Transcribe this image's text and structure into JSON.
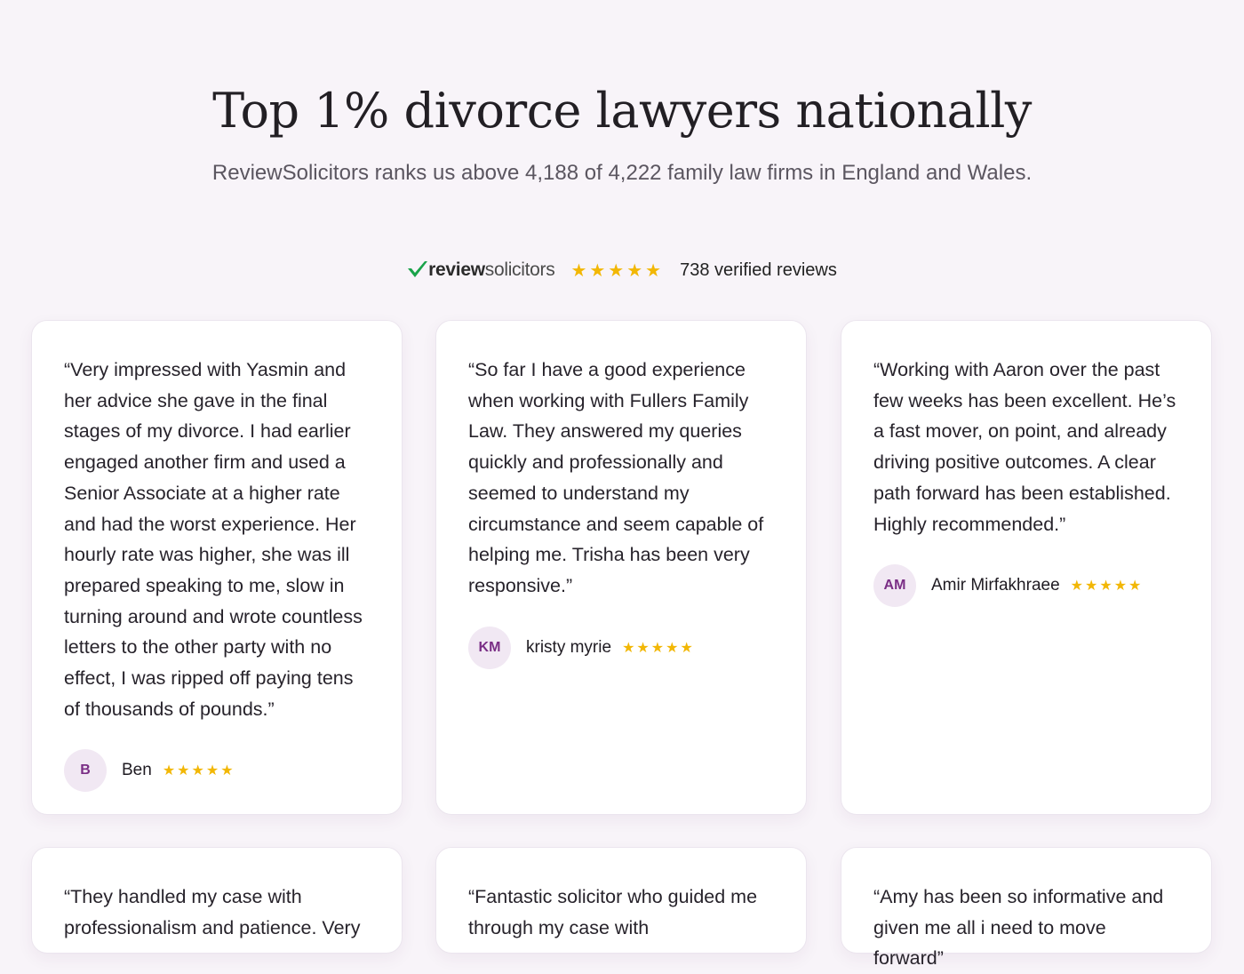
{
  "hero": {
    "title": "Top 1% divorce lawyers nationally",
    "subtitle": "ReviewSolicitors ranks us above 4,188 of 4,222 family law firms in England and Wales."
  },
  "rating_bar": {
    "brand_icon": "check-mark-icon",
    "brand_part1": "review",
    "brand_part2": "solicitors",
    "stars": "★★★★★",
    "rating": 5,
    "reviews_text": "738 verified reviews"
  },
  "colors": {
    "background": "#f8f4f9",
    "star": "#f2b705",
    "avatar_bg": "#f1e8f3",
    "avatar_text": "#7a2e85",
    "brand_check": "#1aa34a"
  },
  "reviews": [
    {
      "quote": "“Very impressed with Yasmin and her advice she gave in the final stages of my divorce. I had earlier engaged another firm and used a Senior Associate at a higher rate and had the worst experience. Her hourly rate was higher, she was ill prepared speaking to me, slow in turning around and wrote countless letters to the other party with no effect, I was ripped off paying tens of thousands of pounds.”",
      "initials": "B",
      "name": "Ben",
      "stars": "★★★★★",
      "rating": 5
    },
    {
      "quote": "“So far I have a good experience when working with Fullers Family Law. They answered my queries quickly and professionally and seemed to understand my circumstance and seem capable of helping me. Trisha has been very responsive.”",
      "initials": "KM",
      "name": "kristy myrie",
      "stars": "★★★★★",
      "rating": 5
    },
    {
      "quote": "“Working with Aaron over the past few weeks has been excellent. He’s a fast mover, on point, and already driving positive outcomes. A clear path forward has been established. Highly recommended.”",
      "initials": "AM",
      "name": "Amir Mirfakhraee",
      "stars": "★★★★★",
      "rating": 5
    },
    {
      "quote": "“They handled my case with professionalism and patience. Very"
    },
    {
      "quote": "“Fantastic solicitor who guided me through my case with"
    },
    {
      "quote": "“Amy has been so informative and given me all i need to move forward”"
    }
  ]
}
